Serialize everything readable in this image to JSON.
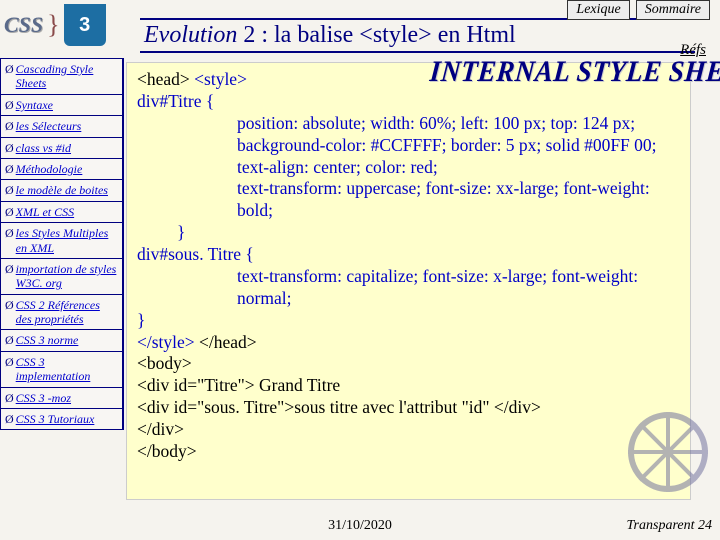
{
  "topbar": {
    "lexique": "Lexique",
    "sommaire": "Sommaire"
  },
  "logo": {
    "text": "CSS",
    "brace": "}",
    "shield": "3"
  },
  "title": {
    "evolution": "Evolution",
    "rest": " 2 : la balise <style> en Html"
  },
  "refs": "Réfs",
  "banner": "INTERNAL STYLE SHEET",
  "sidebar": {
    "items": [
      {
        "label": "Cascading Style Sheets"
      },
      {
        "label": "Syntaxe"
      },
      {
        "label": "les Sélecteurs"
      },
      {
        "label": "class vs #id"
      },
      {
        "label": "Méthodologie"
      },
      {
        "label": "le modèle de boites"
      },
      {
        "label": "XML et CSS"
      },
      {
        "label": "les Styles Multiples en XML"
      },
      {
        "label": "importation de styles W3C. org"
      },
      {
        "label": "CSS 2 Références des propriétés"
      },
      {
        "label": "CSS 3 norme"
      },
      {
        "label": "CSS 3 implementation"
      },
      {
        "label": "CSS 3 -moz"
      },
      {
        "label": "CSS 3 Tutoriaux"
      }
    ]
  },
  "code": {
    "l1a": "<head> ",
    "l1b": "<style>",
    "l2": "div#Titre {",
    "l3": "position: absolute; width: 60%; left: 100 px; top: 124 px;",
    "l4": "background-color: #CCFFFF; border: 5 px; solid #00FF 00;",
    "l5": "text-align: center; color: red;",
    "l6": "text-transform: uppercase;  font-size: xx-large; font-weight: bold;",
    "l7": "}",
    "l8": "div#sous. Titre {",
    "l9": "text-transform: capitalize; font-size: x-large; font-weight: normal;",
    "l10": "}",
    "l11a": "</style>",
    "l11b": " </head>",
    "l12": "<body>",
    "l13": "<div id=\"Titre\"> Grand Titre",
    "l14": "  <div id=\"sous. Titre\">sous titre avec l'attribut \"id\" </div>",
    "l15": "</div>",
    "l16": "</body>"
  },
  "footer": {
    "date": "31/10/2020",
    "page": "Transparent 24"
  }
}
